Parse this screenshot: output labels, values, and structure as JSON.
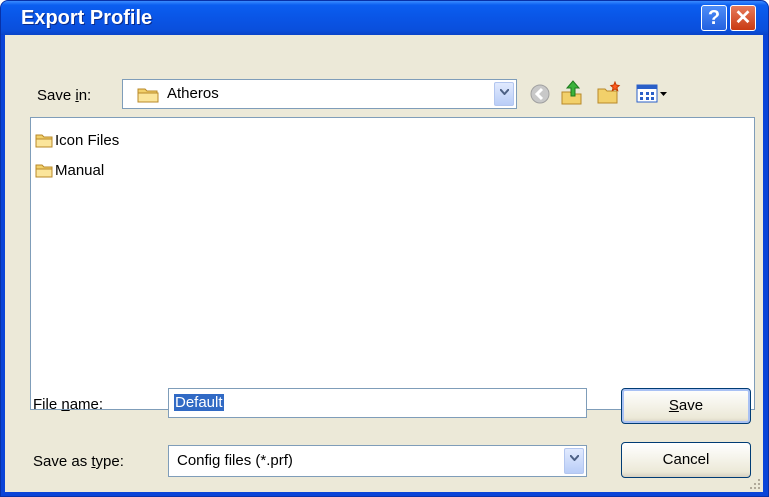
{
  "window": {
    "title": "Export Profile"
  },
  "save_in": {
    "label_pre": "Save ",
    "label_mnemonic": "i",
    "label_post": "n:",
    "value": "Atheros"
  },
  "files": [
    {
      "name": "Icon Files",
      "icon": "folder-icon"
    },
    {
      "name": "Manual",
      "icon": "folder-icon"
    }
  ],
  "file_name": {
    "label_pre": "File ",
    "label_mnemonic": "n",
    "label_post": "ame:",
    "value": "Default"
  },
  "save_as_type": {
    "label_pre": "Save as ",
    "label_mnemonic": "t",
    "label_post": "ype:",
    "value": "Config files (*.prf)"
  },
  "buttons": {
    "save_mnemonic": "S",
    "save_rest": "ave",
    "cancel": "Cancel"
  },
  "colors": {
    "title_bar": "#0a55e6",
    "dialog_bg": "#ece9d8",
    "selection": "#316ac5"
  }
}
